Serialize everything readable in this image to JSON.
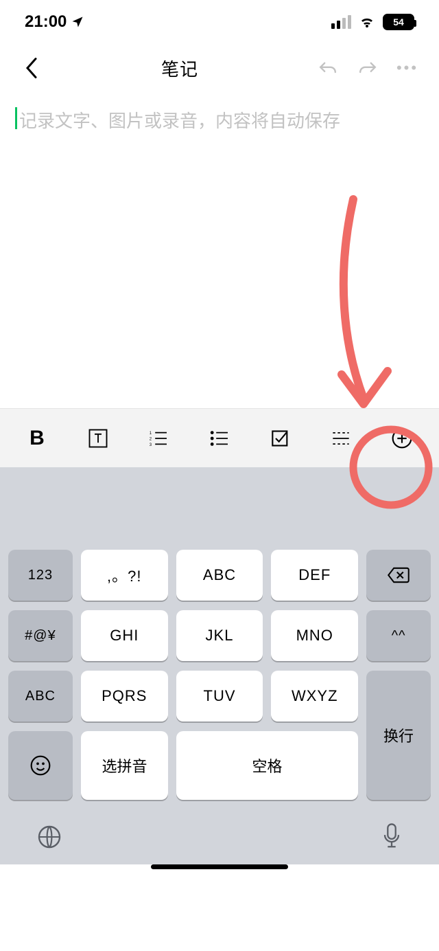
{
  "status": {
    "time": "21:00",
    "battery": "54"
  },
  "nav": {
    "title": "笔记"
  },
  "editor": {
    "placeholder": "记录文字、图片或录音，内容将自动保存"
  },
  "keyboard": {
    "r1": [
      "123",
      ",。?!",
      "ABC",
      "DEF"
    ],
    "r2": [
      "#@¥",
      "GHI",
      "JKL",
      "MNO",
      "^^"
    ],
    "r3": [
      "ABC",
      "PQRS",
      "TUV",
      "WXYZ"
    ],
    "r4_enter": "换行",
    "r5_pinyin": "选拼音",
    "r5_space": "空格"
  }
}
